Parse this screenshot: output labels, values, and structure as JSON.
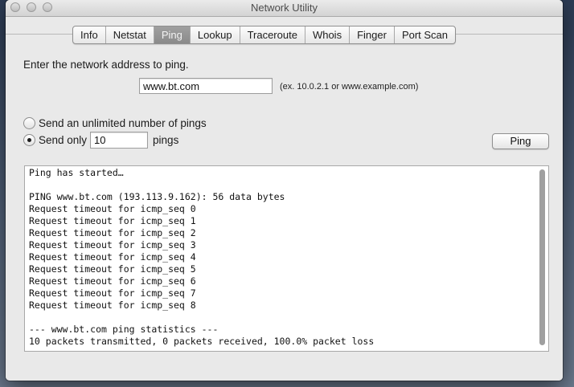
{
  "window": {
    "title": "Network Utility"
  },
  "tabs": [
    {
      "label": "Info"
    },
    {
      "label": "Netstat"
    },
    {
      "label": "Ping",
      "active": true
    },
    {
      "label": "Lookup"
    },
    {
      "label": "Traceroute"
    },
    {
      "label": "Whois"
    },
    {
      "label": "Finger"
    },
    {
      "label": "Port Scan"
    }
  ],
  "ping": {
    "prompt": "Enter the network address to ping.",
    "address_value": "www.bt.com",
    "example": "(ex. 10.0.2.1 or www.example.com)",
    "unlimited_label": "Send an unlimited number of pings",
    "send_only_label": "Send only",
    "count_value": "10",
    "pings_label": "pings",
    "selected_mode": "send-only",
    "button_label": "Ping"
  },
  "output": {
    "lines": [
      "Ping has started…",
      "",
      "PING www.bt.com (193.113.9.162): 56 data bytes",
      "Request timeout for icmp_seq 0",
      "Request timeout for icmp_seq 1",
      "Request timeout for icmp_seq 2",
      "Request timeout for icmp_seq 3",
      "Request timeout for icmp_seq 4",
      "Request timeout for icmp_seq 5",
      "Request timeout for icmp_seq 6",
      "Request timeout for icmp_seq 7",
      "Request timeout for icmp_seq 8",
      "",
      "--- www.bt.com ping statistics ---",
      "10 packets transmitted, 0 packets received, 100.0% packet loss"
    ]
  }
}
